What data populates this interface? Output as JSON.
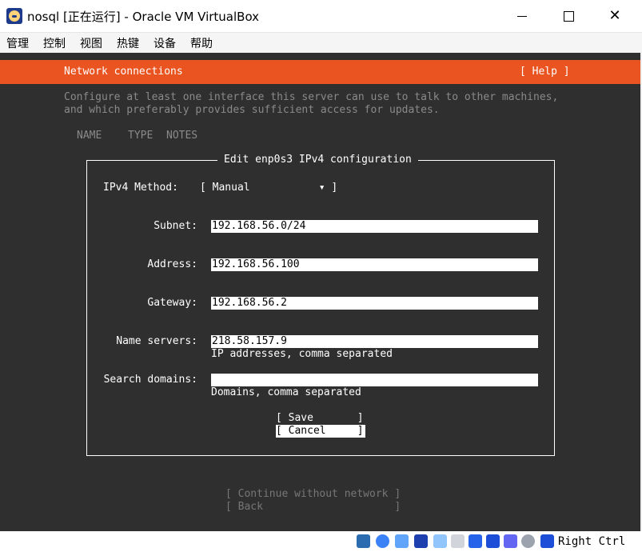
{
  "window": {
    "title": "nosql [正在运行] - Oracle VM VirtualBox",
    "min_glyph": "",
    "max_glyph": "",
    "close_glyph": "✕"
  },
  "menu": [
    "管理",
    "控制",
    "视图",
    "热键",
    "设备",
    "帮助"
  ],
  "installer": {
    "header_title": "Network connections",
    "help_label": "[ Help ]",
    "description_line1": "Configure at least one interface this server can use to talk to other machines,",
    "description_line2": "and which preferably provides sufficient access for updates.",
    "columns": [
      "NAME",
      "TYPE",
      "NOTES"
    ],
    "accent_color": "#e95420"
  },
  "dialog": {
    "title": "Edit enp0s3 IPv4 configuration",
    "method_label": "IPv4 Method:",
    "method_value": "[ Manual           ▾ ]",
    "subnet_label": "Subnet:",
    "subnet_value": "192.168.56.0/24",
    "address_label": "Address:",
    "address_value": "192.168.56.100",
    "gateway_label": "Gateway:",
    "gateway_value": "192.168.56.2",
    "nameservers_label": "Name servers:",
    "nameservers_value": "218.58.157.9",
    "nameservers_hint": "IP addresses, comma separated",
    "searchdomains_label": "Search domains:",
    "searchdomains_value": "",
    "searchdomains_hint": "Domains, comma separated",
    "save_label": "[ Save       ]",
    "cancel_label": "[ Cancel     ]"
  },
  "footer": {
    "continue_label": "[ Continue without network ]",
    "back_label": "[ Back                     ]"
  },
  "statusbar": {
    "icons": [
      "hard-disk-icon",
      "optical-drive-icon",
      "audio-icon",
      "network-icon",
      "usb-icon",
      "shared-folder-icon",
      "display-icon",
      "video-capture-icon",
      "recording-icon",
      "mouse-integration-icon",
      "keyboard-icon"
    ],
    "host_key": "Right Ctrl"
  }
}
